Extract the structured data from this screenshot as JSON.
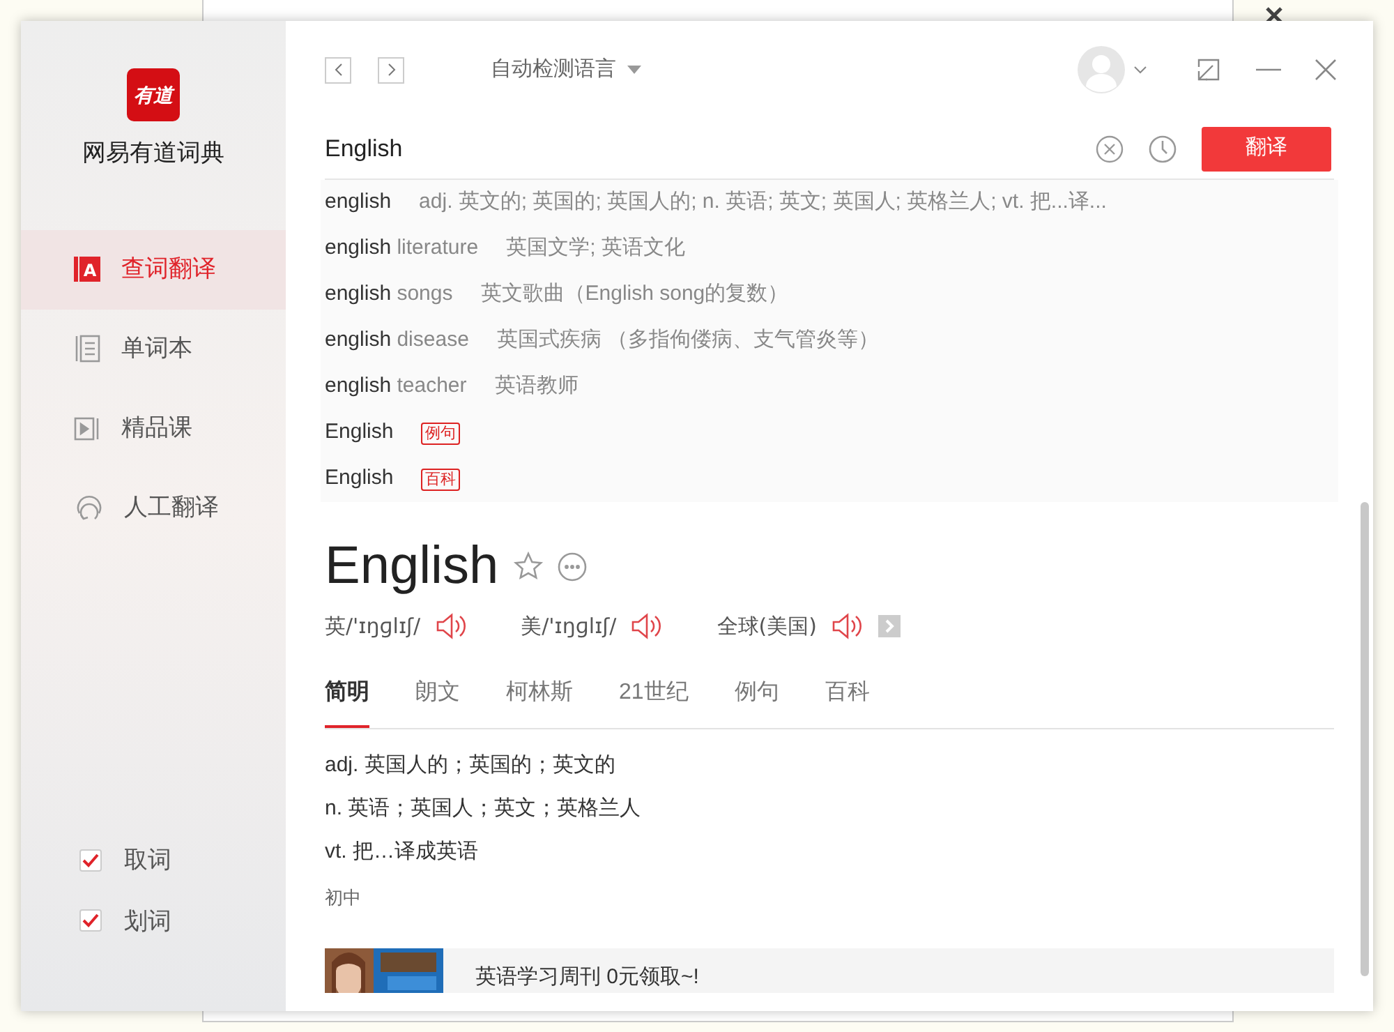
{
  "app": {
    "logo": "有道",
    "name": "网易有道词典"
  },
  "sidebar": {
    "items": [
      {
        "label": "查词翻译",
        "kind": "dict",
        "icon_letter": "A",
        "selected": true
      },
      {
        "label": "单词本",
        "kind": "book",
        "selected": false
      },
      {
        "label": "精品课",
        "kind": "course",
        "selected": false
      },
      {
        "label": "人工翻译",
        "kind": "human",
        "selected": false
      }
    ],
    "options": [
      {
        "label": "取词",
        "checked": true
      },
      {
        "label": "划词",
        "checked": true
      }
    ]
  },
  "toolbar": {
    "language": "自动检测语言"
  },
  "search": {
    "value": "English",
    "button": "翻译"
  },
  "suggestions": [
    {
      "kind": "definition",
      "match": "english",
      "meaning": "adj. 英文的; 英国的; 英国人的; n. 英语; 英文; 英国人; 英格兰人; vt. 把...译..."
    },
    {
      "kind": "definition",
      "match": "english",
      "rest": " literature",
      "meaning": "英国文学; 英语文化"
    },
    {
      "kind": "definition",
      "match": "english",
      "rest": " songs",
      "meaning": "英文歌曲（English song的复数）"
    },
    {
      "kind": "definition",
      "match": "english",
      "rest": " disease",
      "meaning": "英国式疾病 （多指佝偻病、支气管炎等）"
    },
    {
      "kind": "definition",
      "match": "english",
      "rest": " teacher",
      "meaning": "英语教师"
    },
    {
      "kind": "tag",
      "match": "English",
      "tag": "例句"
    },
    {
      "kind": "tag",
      "match": "English",
      "tag": "百科"
    }
  ],
  "entry": {
    "word": "English",
    "pronunciations": [
      {
        "label": "英/'ɪŋɡlɪʃ/"
      },
      {
        "label": "美/'ɪŋɡlɪʃ/"
      },
      {
        "label": "全球(美国)"
      }
    ],
    "tabs": [
      {
        "label": "简明",
        "selected": true
      },
      {
        "label": "朗文",
        "selected": false
      },
      {
        "label": "柯林斯",
        "selected": false
      },
      {
        "label": "21世纪",
        "selected": false
      },
      {
        "label": "例句",
        "selected": false
      },
      {
        "label": "百科",
        "selected": false
      }
    ],
    "definitions": [
      "adj. 英国人的；英国的；英文的",
      "n. 英语；英国人；英文；英格兰人",
      "vt. 把…译成英语"
    ],
    "level": "初中"
  },
  "ad": {
    "kind": "picture",
    "text": "英语学习周刊 0元领取~!"
  }
}
